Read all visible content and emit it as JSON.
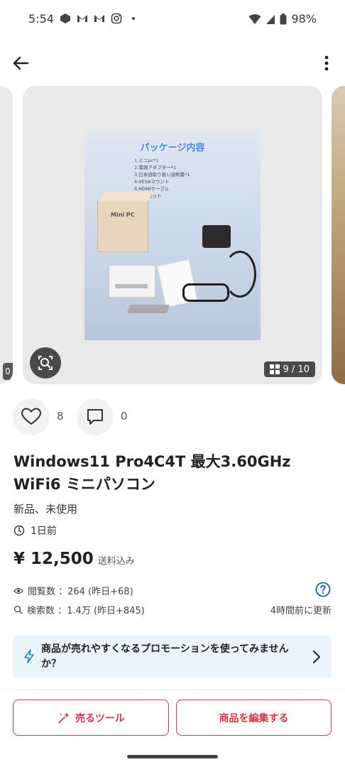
{
  "status_bar": {
    "time": "5:54",
    "battery": "98%",
    "left_icons": [
      "app-icon",
      "gmail-icon",
      "gmail-icon",
      "instagram-icon",
      "dot-icon"
    ],
    "right_icons": [
      "wifi-icon",
      "signal-icon",
      "battery-icon"
    ]
  },
  "app_bar": {
    "back_icon": "arrow-left-icon",
    "more_icon": "more-vertical-icon"
  },
  "gallery": {
    "image_title": "パッケージ内容",
    "image_list": [
      "1.ミニpc*1",
      "2.電源アダプター*1",
      "3.日本語取り扱い説明書*1",
      "4.VESAマウント",
      "5.HDMIケーブル",
      "6.ネジセット"
    ],
    "box_label": "Mini PC",
    "page_indicator": "9 / 10",
    "prev_badge": "0",
    "lens_icon": "lens-search-icon",
    "grid_icon": "grid-icon"
  },
  "actions": {
    "like_count": "8",
    "comment_count": "0"
  },
  "product": {
    "title": "Windows11 Pro4C4T 最大3.60GHz WiFi6 ミニパソコン",
    "condition": "新品、未使用",
    "posted": "1日前",
    "price": "¥ 12,500",
    "shipping": "送料込み"
  },
  "stats": {
    "views": "閲覧数 ：264 (昨日+68)",
    "searches": "検索数 ：1.4万 (昨日+845)",
    "updated": "4時間前に更新"
  },
  "promo": {
    "text": "商品が売れやすくなるプロモーションを使ってみませんか？"
  },
  "buttons": {
    "sell_tool": "売るツール",
    "edit": "商品を編集する"
  },
  "colors": {
    "accent": "#e0344a",
    "promo_bg": "#eaf5fb",
    "link_blue": "#1a5fb4"
  }
}
